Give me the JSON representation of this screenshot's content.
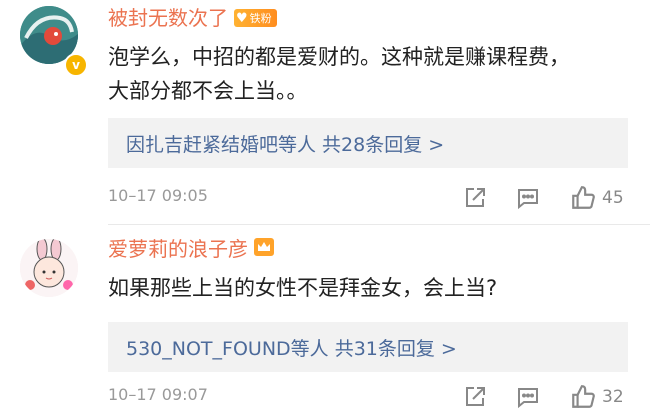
{
  "comments": [
    {
      "username": "被封无数次了",
      "badge_text": "铁粉",
      "verified_icon": "v",
      "text_line1": "泡学么，中招的都是爱财的。这种就是赚课程费，",
      "text_line2": "大部分都不会上当。。",
      "replies_summary": "因扎吉赶紧结婚吧等人 共28条回复 >",
      "time": "10–17 09:05",
      "likes": "45"
    },
    {
      "username": "爱萝莉的浪子彦",
      "text_line1": "如果那些上当的女性不是拜金女，会上当?",
      "replies_summary": "530_NOT_FOUND等人 共31条回复 >",
      "time": "10–17 09:07",
      "likes": "32"
    }
  ],
  "colors": {
    "username": "#eb7350",
    "link": "#4c6a9a",
    "meta": "#999999",
    "reply_bg": "#f2f2f2",
    "badge": "#ffa32a"
  },
  "icons": [
    "avatar-wave",
    "avatar-bunny-girl",
    "verified-badge",
    "fan-heart-badge",
    "crown-badge",
    "share-icon",
    "comment-icon",
    "like-thumb-icon"
  ]
}
